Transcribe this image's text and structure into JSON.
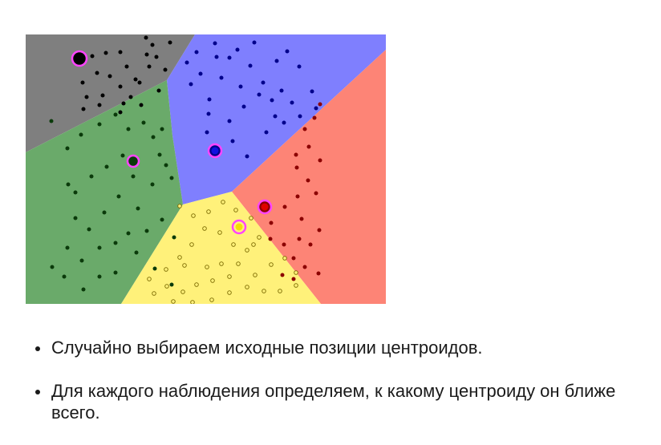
{
  "bullets": [
    {
      "text": "Случайно выбираем исходные позиции центроидов."
    },
    {
      "text": "Для каждого наблюдения определяем, к какому центроиду он ближе всего."
    }
  ],
  "clusters": [
    {
      "name": "gray",
      "region_color": "#7f7f7f",
      "point_color": "#000000"
    },
    {
      "name": "blue",
      "region_color": "#7f7ffe",
      "point_color": "#00008b"
    },
    {
      "name": "green",
      "region_color": "#6aaa6a",
      "point_color": "#0a3a0a"
    },
    {
      "name": "red",
      "region_color": "#fd8476",
      "point_color": "#8b0000"
    },
    {
      "name": "yellow",
      "region_color": "#fff17a",
      "point_color": "#7a6a00"
    }
  ],
  "centroid_ring_color": "#ff44ff"
}
